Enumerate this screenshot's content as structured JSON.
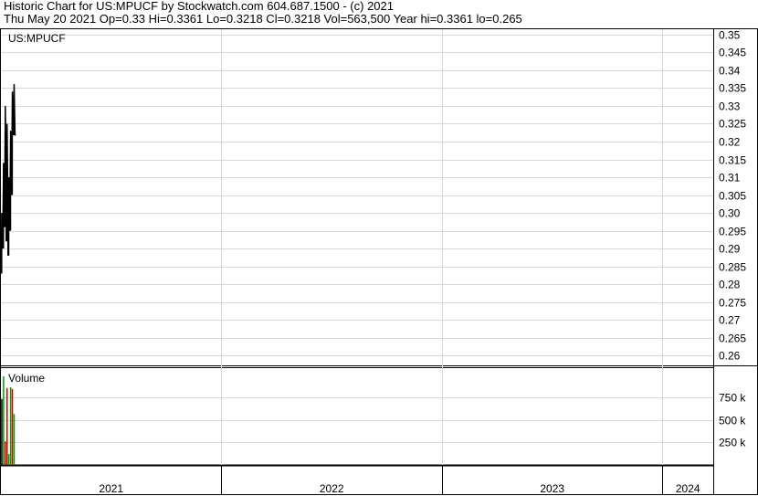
{
  "header": {
    "line1": "Historic Chart for US:MPUCF by Stockwatch.com 604.687.1500 - (c) 2021",
    "line2": "Thu May 20 2021  Op=0.33  Hi=0.3361  Lo=0.3218  Cl=0.3218  Vol=563,500  Year hi=0.3361  lo=0.265"
  },
  "chart_data": [
    {
      "type": "line",
      "label": "US:MPUCF",
      "y_ticks": [
        "0.35",
        "0.345",
        "0.34",
        "0.335",
        "0.33",
        "0.325",
        "0.32",
        "0.315",
        "0.31",
        "0.305",
        "0.30",
        "0.295",
        "0.29",
        "0.285",
        "0.28",
        "0.275",
        "0.27",
        "0.265",
        "0.26"
      ],
      "ylim": [
        0.2575,
        0.3515
      ],
      "xlim": [
        2021.0,
        2024.23
      ],
      "year_labels": [
        {
          "label": "2021",
          "start": 2021.0,
          "end": 2022.0
        },
        {
          "label": "2022",
          "start": 2022.0,
          "end": 2023.0
        },
        {
          "label": "2023",
          "start": 2023.0,
          "end": 2024.0
        },
        {
          "label": "2024",
          "start": 2024.0,
          "end": 2024.23
        }
      ],
      "bars": [
        {
          "x": 2021.004,
          "high": 0.3,
          "low": 0.283,
          "close": 0.292
        },
        {
          "x": 2021.012,
          "high": 0.314,
          "low": 0.29,
          "close": 0.305
        },
        {
          "x": 2021.02,
          "high": 0.33,
          "low": 0.296,
          "close": 0.312
        },
        {
          "x": 2021.028,
          "high": 0.325,
          "low": 0.292,
          "close": 0.3
        },
        {
          "x": 2021.036,
          "high": 0.31,
          "low": 0.288,
          "close": 0.296
        },
        {
          "x": 2021.044,
          "high": 0.323,
          "low": 0.295,
          "close": 0.315
        },
        {
          "x": 2021.052,
          "high": 0.334,
          "low": 0.305,
          "close": 0.322
        },
        {
          "x": 2021.06,
          "high": 0.3361,
          "low": 0.3218,
          "close": 0.3218
        }
      ],
      "grid": true
    },
    {
      "type": "bar",
      "label": "Volume",
      "y_ticks": [
        "750 k",
        "500 k",
        "250 k"
      ],
      "ylim": [
        0,
        1000000
      ],
      "bars": [
        {
          "x": 2021.004,
          "value": 730000,
          "color": "#000000"
        },
        {
          "x": 2021.012,
          "value": 980000,
          "color": "#00a000"
        },
        {
          "x": 2021.02,
          "value": 260000,
          "color": "#d00000"
        },
        {
          "x": 2021.028,
          "value": 850000,
          "color": "#d00000"
        },
        {
          "x": 2021.036,
          "value": 120000,
          "color": "#00a000"
        },
        {
          "x": 2021.044,
          "value": 860000,
          "color": "#00a000"
        },
        {
          "x": 2021.052,
          "value": 840000,
          "color": "#d00000"
        },
        {
          "x": 2021.06,
          "value": 563500,
          "color": "#00a000"
        }
      ],
      "grid": true
    }
  ]
}
